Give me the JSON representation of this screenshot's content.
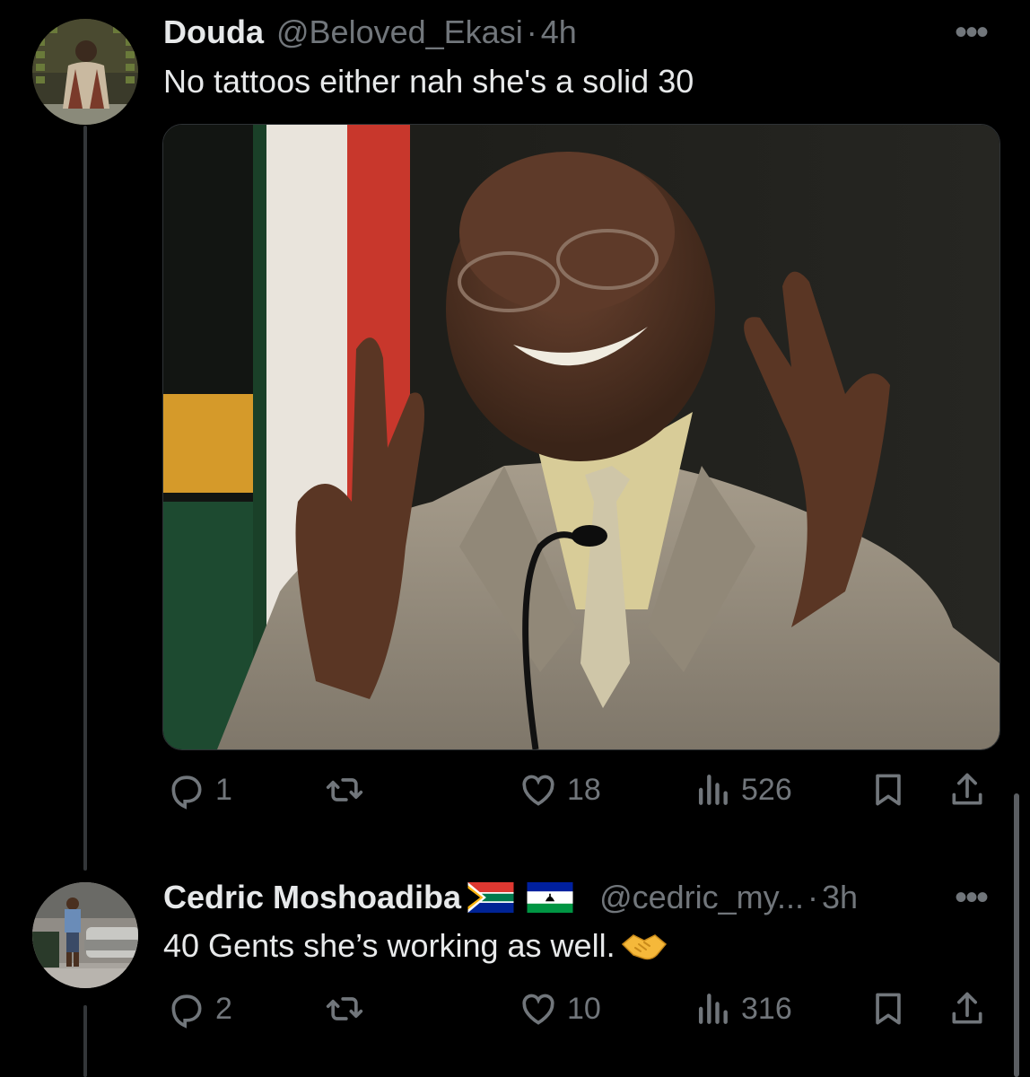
{
  "tweets": [
    {
      "name": "Douda",
      "handle": "@Beloved_Ekasi",
      "separator": "·",
      "time": "4h",
      "text": "No tattoos either nah she's a solid 30",
      "more": "•••",
      "stats": {
        "replies": "1",
        "likes": "18",
        "views": "526"
      }
    },
    {
      "name": "Cedric Moshoadiba",
      "handle": "@cedric_my...",
      "separator": "·",
      "time": "3h",
      "text": "40 Gents she’s working as well.",
      "more": "•••",
      "stats": {
        "replies": "2",
        "likes": "10",
        "views": "316"
      }
    }
  ],
  "icons": [
    "reply-icon",
    "retweet-icon",
    "like-icon",
    "views-icon",
    "bookmark-icon",
    "share-icon",
    "more-icon",
    "south-africa-flag",
    "lesotho-flag",
    "handshake-emoji"
  ],
  "colors": {
    "background": "#000000",
    "text": "#e7e9ea",
    "muted": "#71767b",
    "border": "#2f3336"
  }
}
